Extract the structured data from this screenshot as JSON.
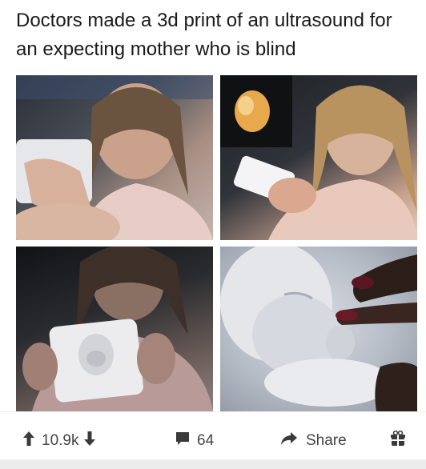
{
  "post": {
    "title": "Doctors made a 3d print of an ultrasound for an expecting mother who is blind"
  },
  "actions": {
    "upvote_icon": "arrow-up-icon",
    "vote_count": "10.9k",
    "downvote_icon": "arrow-down-icon",
    "comment_icon": "speech-bubble-icon",
    "comment_count": "64",
    "share_icon": "share-arrow-icon",
    "share_label": "Share",
    "award_icon": "gift-icon"
  },
  "colors": {
    "text": "#1a1a1a",
    "icon": "#3a3a3a",
    "background": "#ffffff"
  }
}
